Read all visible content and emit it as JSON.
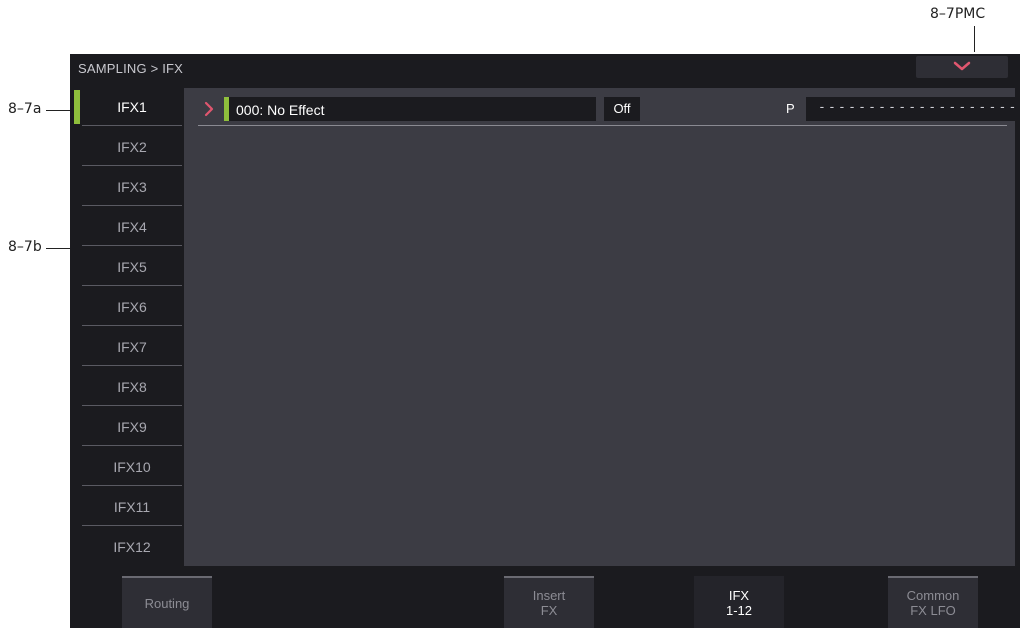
{
  "annotations": {
    "pmc": "8–7PMC",
    "left_a": "8–7a",
    "left_b": "8–7b"
  },
  "title_bar": {
    "breadcrumb": "SAMPLING > IFX",
    "pmc_icon": "chevron-down-icon"
  },
  "sidebar": {
    "active_index": 0,
    "tabs": [
      "IFX1",
      "IFX2",
      "IFX3",
      "IFX4",
      "IFX5",
      "IFX6",
      "IFX7",
      "IFX8",
      "IFX9",
      "IFX10",
      "IFX11",
      "IFX12"
    ]
  },
  "effect_row": {
    "effect_name": "000: No Effect",
    "on_off": "Off",
    "p_label": "P",
    "p_value": "---------------------"
  },
  "footer": {
    "tabs": [
      {
        "line1": "Routing",
        "line2": ""
      },
      {
        "line1": "Insert",
        "line2": "FX"
      },
      {
        "line1": "IFX",
        "line2": "1-12"
      },
      {
        "line1": "Common",
        "line2": "FX LFO"
      }
    ],
    "active_index": 2
  },
  "colors": {
    "accent_green": "#8fbf3c",
    "chevron_pink": "#e0566f"
  }
}
